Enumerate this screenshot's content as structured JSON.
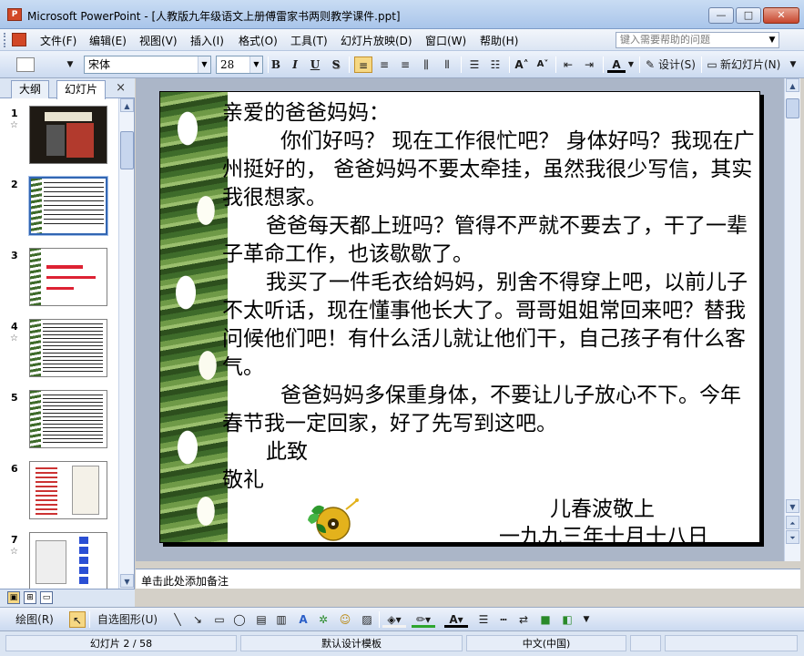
{
  "window": {
    "title": "Microsoft PowerPoint - [人教版九年级语文上册傅雷家书两则教学课件.ppt]",
    "icon": "powerpoint-app-icon",
    "buttons": {
      "minimize": "—",
      "maximize": "□",
      "close": "✕"
    }
  },
  "menubar": {
    "items": [
      "文件(F)",
      "编辑(E)",
      "视图(V)",
      "插入(I)",
      "格式(O)",
      "工具(T)",
      "幻灯片放映(D)",
      "窗口(W)",
      "帮助(H)"
    ],
    "help_placeholder": "键入需要帮助的问题"
  },
  "toolbar": {
    "font_name": "宋体",
    "font_size": "28",
    "bold": "B",
    "italic": "I",
    "underline": "U",
    "shadow": "S",
    "design_label": "设计(S)",
    "new_slide_label": "新幻灯片(N)",
    "font_color_label": "A"
  },
  "leftpanel": {
    "tabs": [
      "大纲",
      "幻灯片"
    ],
    "active_tab": "幻灯片",
    "close_glyph": "×",
    "slides": [
      {
        "num": "1",
        "has_star": true,
        "selected": false
      },
      {
        "num": "2",
        "has_star": false,
        "selected": true
      },
      {
        "num": "3",
        "has_star": false,
        "selected": false
      },
      {
        "num": "4",
        "has_star": true,
        "selected": false
      },
      {
        "num": "5",
        "has_star": false,
        "selected": false
      },
      {
        "num": "6",
        "has_star": false,
        "selected": false
      },
      {
        "num": "7",
        "has_star": true,
        "selected": false
      }
    ],
    "star_glyph": "☆"
  },
  "slide": {
    "greeting": "亲爱的爸爸妈妈：",
    "paragraphs": [
      "你们好吗？ 现在工作很忙吧？ 身体好吗？我现在广州挺好的， 爸爸妈妈不要太牵挂，虽然我很少写信，其实我很想家。",
      "爸爸每天都上班吗？管得不严就不要去了，干了一辈子革命工作，也该歇歇了。",
      "我买了一件毛衣给妈妈，别舍不得穿上吧，以前儿子不太听话，现在懂事他长大了。哥哥姐姐常回来吧？替我问候他们吧！有什么活儿就让他们干，自己孩子有什么客气。",
      "爸爸妈妈多保重身体，不要让儿子放心不下。今年春节我一定回家，好了先写到这吧。"
    ],
    "closing_1": "此致",
    "closing_2": "敬礼",
    "signature": "儿春波敬上",
    "date": "一九九三年十月十八日"
  },
  "notes": {
    "placeholder": "单击此处添加备注"
  },
  "drawbar": {
    "draw_label": "绘图(R)",
    "autoshapes_label": "自选图形(U)"
  },
  "status": {
    "slide_indicator": "幻灯片 2 / 58",
    "template": "默认设计模板",
    "language": "中文(中国)"
  }
}
